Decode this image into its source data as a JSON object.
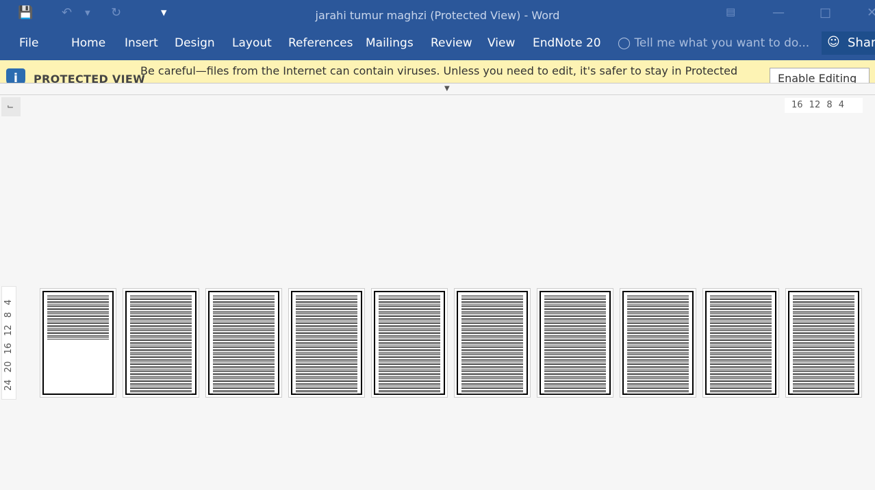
{
  "window": {
    "title": "jarahi tumur maghzi (Protected View) - Word"
  },
  "qat": {
    "save": "save-icon",
    "undo": "undo-icon",
    "redo": "redo-icon",
    "customize": "customize-icon"
  },
  "ribbon": {
    "tabs": [
      "File",
      "Home",
      "Insert",
      "Design",
      "Layout",
      "References",
      "Mailings",
      "Review",
      "View",
      "EndNote 20"
    ],
    "tell_me": "Tell me what you want to do...",
    "share": "Share"
  },
  "protected_view": {
    "label": "PROTECTED VIEW",
    "message": "Be careful—files from the Internet can contain viruses. Unless you need to edit, it's safer to stay in Protected",
    "enable_button": "Enable Editing"
  },
  "rulers": {
    "horizontal": "16 12 8 4",
    "vertical": "24 20 16 12 8 4"
  },
  "pages": [
    {
      "fill": 0.45
    },
    {
      "fill": 1
    },
    {
      "fill": 1
    },
    {
      "fill": 1
    },
    {
      "fill": 1
    },
    {
      "fill": 1
    },
    {
      "fill": 1
    },
    {
      "fill": 1
    },
    {
      "fill": 1
    },
    {
      "fill": 1
    }
  ],
  "colors": {
    "accent": "#2b579a",
    "warning_bar": "#fdf3b4"
  }
}
